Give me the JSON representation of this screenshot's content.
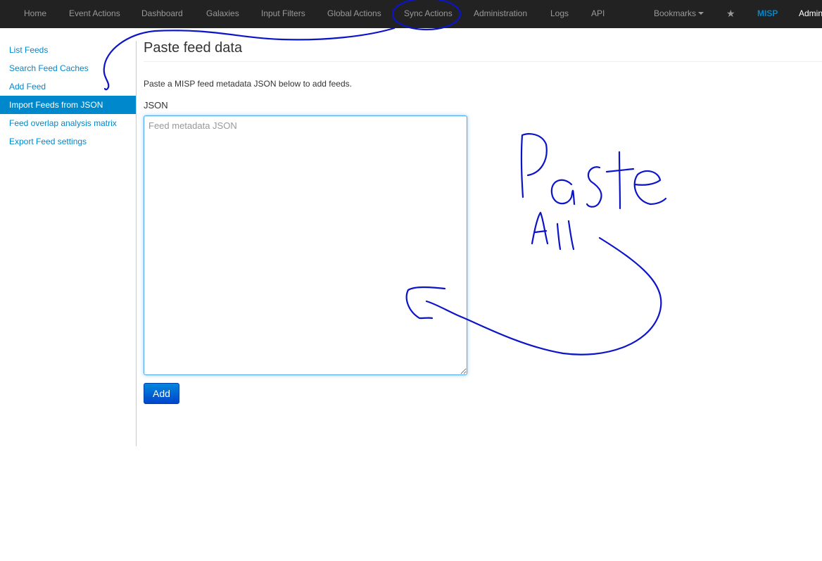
{
  "navbar": {
    "items": [
      {
        "label": "Home"
      },
      {
        "label": "Event Actions"
      },
      {
        "label": "Dashboard"
      },
      {
        "label": "Galaxies"
      },
      {
        "label": "Input Filters"
      },
      {
        "label": "Global Actions"
      },
      {
        "label": "Sync Actions"
      },
      {
        "label": "Administration"
      },
      {
        "label": "Logs"
      },
      {
        "label": "API"
      }
    ],
    "bookmarks_label": "Bookmarks",
    "star_icon": "star-icon",
    "brand_label": "MISP",
    "user_label": "Admin"
  },
  "sidebar": {
    "items": [
      {
        "label": "List Feeds",
        "active": false
      },
      {
        "label": "Search Feed Caches",
        "active": false
      },
      {
        "label": "Add Feed",
        "active": false
      },
      {
        "label": "Import Feeds from JSON",
        "active": true
      },
      {
        "label": "Feed overlap analysis matrix",
        "active": false
      },
      {
        "label": "Export Feed settings",
        "active": false
      }
    ]
  },
  "main": {
    "title": "Paste feed data",
    "description": "Paste a MISP feed metadata JSON below to add feeds.",
    "json_label": "JSON",
    "json_placeholder": "Feed metadata JSON",
    "json_value": "",
    "add_button_label": "Add"
  },
  "colors": {
    "navbar_bg": "#222222",
    "accent": "#0088cc",
    "annotation_ink": "#0c14c8"
  }
}
